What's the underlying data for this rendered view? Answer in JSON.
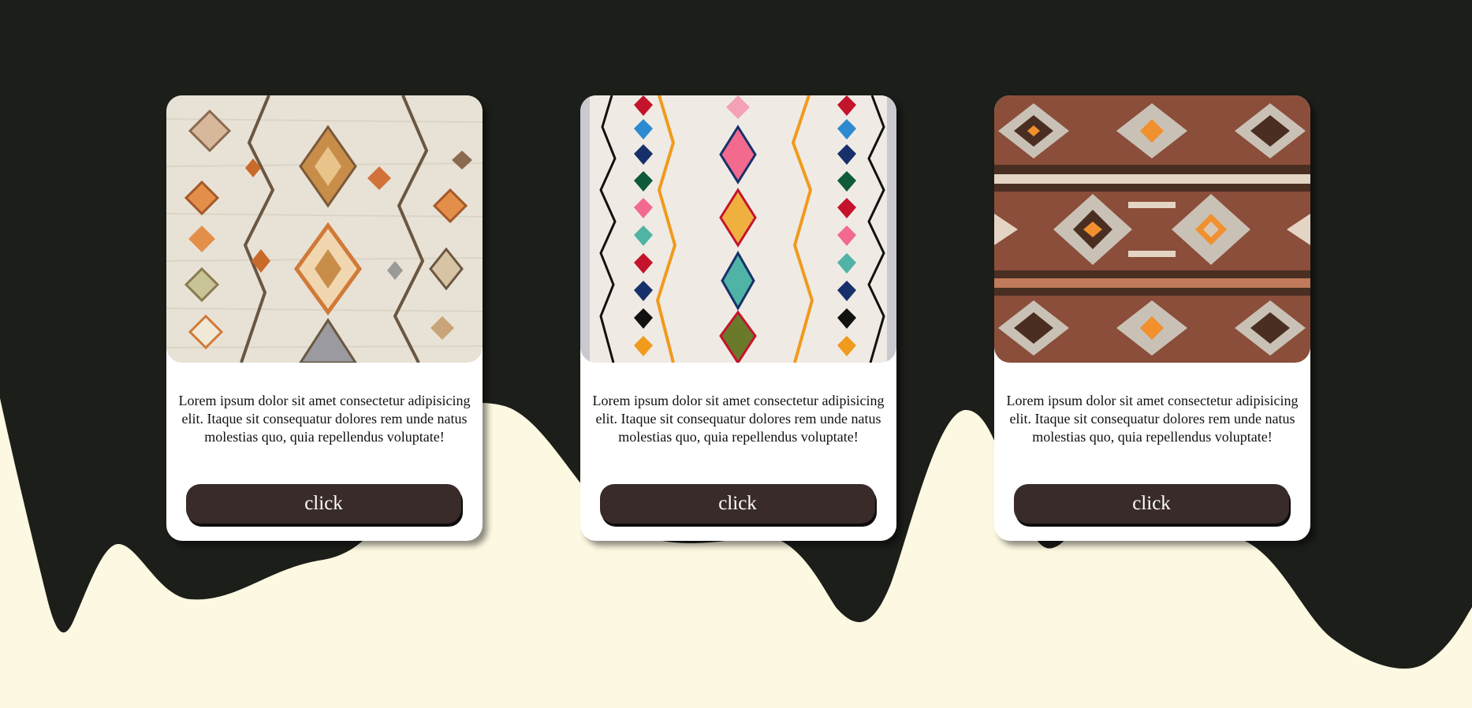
{
  "colors": {
    "dark_background": "#1c1e1a",
    "cream_wave": "#fdf8e1",
    "card_background": "#ffffff",
    "button_background": "#382b2a",
    "button_text": "#ffffff"
  },
  "cards": [
    {
      "image_icon": "beige-diamond-rug-pattern",
      "description": "Lorem ipsum dolor sit amet consectetur adipisicing elit. Itaque sit consequatur dolores rem unde natus molestias quo, quia repellendus voluptate!",
      "button_label": "click"
    },
    {
      "image_icon": "white-berber-rug-pattern",
      "description": "Lorem ipsum dolor sit amet consectetur adipisicing elit. Itaque sit consequatur dolores rem unde natus molestias quo, quia repellendus voluptate!",
      "button_label": "click"
    },
    {
      "image_icon": "brown-kilim-rug-pattern",
      "description": "Lorem ipsum dolor sit amet consectetur adipisicing elit. Itaque sit consequatur dolores rem unde natus molestias quo, quia repellendus voluptate!",
      "button_label": "click"
    }
  ]
}
